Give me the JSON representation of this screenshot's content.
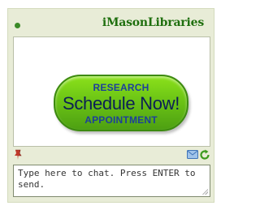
{
  "widget": {
    "title": "iMasonLibraries",
    "status_indicator": "online",
    "status_color": "#3a8a27",
    "accent_color": "#1f6f0e"
  },
  "promo_button": {
    "top_label": "RESEARCH",
    "main_label": "Schedule Now!",
    "bottom_label": "APPOINTMENT",
    "button_color": "#6fc716"
  },
  "toolbar": {
    "icons": [
      "pin-icon",
      "email-icon",
      "refresh-icon"
    ]
  },
  "chat_input": {
    "placeholder": "Type here to chat. Press ENTER to send."
  }
}
